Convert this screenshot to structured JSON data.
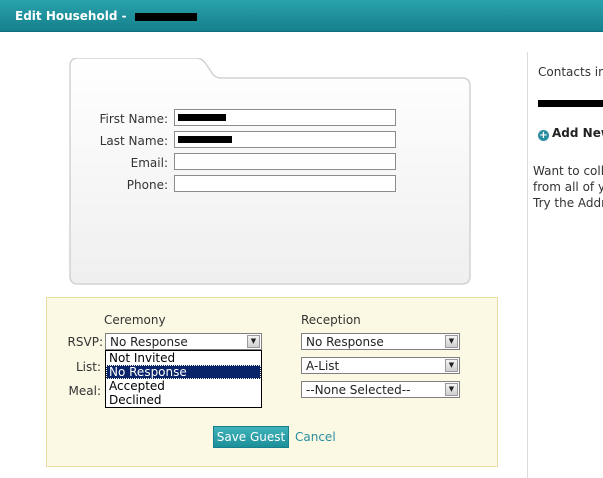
{
  "header": {
    "title": "Edit Household - "
  },
  "form": {
    "first_name_label": "First Name:",
    "last_name_label": "Last Name:",
    "email_label": "Email:",
    "phone_label": "Phone:"
  },
  "events": {
    "ceremony": {
      "heading": "Ceremony",
      "rsvp_label": "RSVP:",
      "list_label": "List:",
      "meal_label": "Meal:",
      "rsvp_value": "No Response",
      "rsvp_options": [
        "Not Invited",
        "No Response",
        "Accepted",
        "Declined"
      ],
      "rsvp_selected_index": 1
    },
    "reception": {
      "heading": "Reception",
      "rsvp_value": "No Response",
      "list_value": "A-List",
      "meal_value": "--None Selected--"
    }
  },
  "actions": {
    "save_label": "Save Guest",
    "cancel_label": "Cancel"
  },
  "sidebar": {
    "contacts_label": "Contacts in",
    "add_new_label": "Add New",
    "help_lines": [
      "Want to colle",
      "from all of yo",
      "Try the Addr"
    ]
  },
  "colors": {
    "header": "#15808b",
    "panel": "#fbf8e3",
    "link": "#2a8ea0",
    "select_highlight": "#0a246a"
  }
}
